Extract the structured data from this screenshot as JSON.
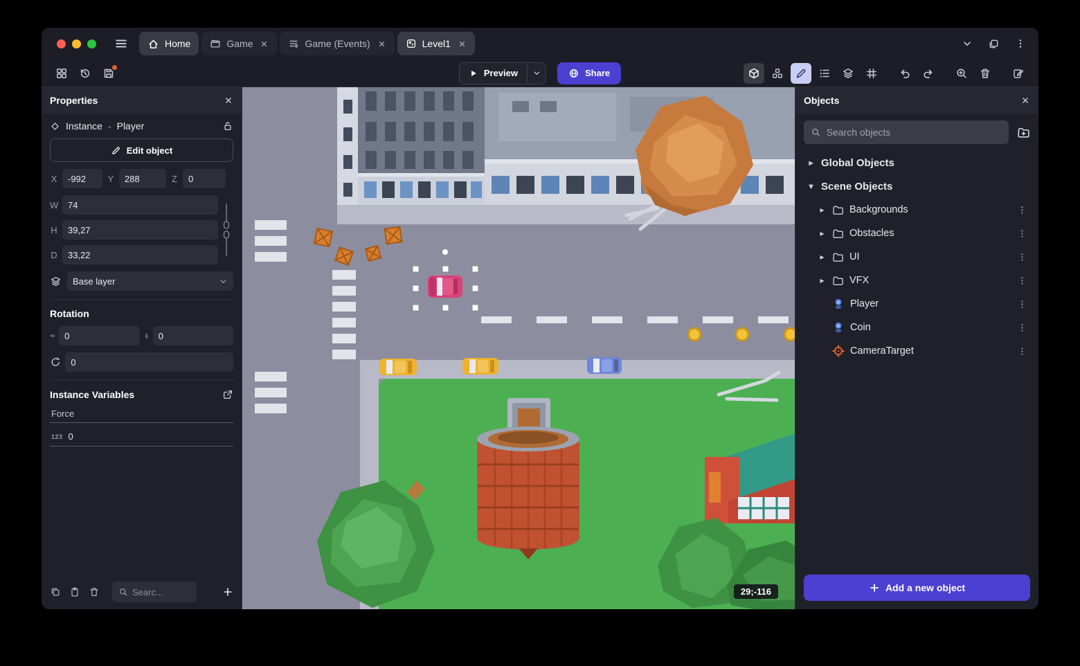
{
  "titlebar": {
    "tabs": [
      {
        "label": "Home"
      },
      {
        "label": "Game"
      },
      {
        "label": "Game (Events)"
      },
      {
        "label": "Level1"
      }
    ]
  },
  "toolbar": {
    "preview_label": "Preview",
    "share_label": "Share"
  },
  "properties_panel": {
    "title": "Properties",
    "instance_label": "Instance",
    "separator": "-",
    "object_name": "Player",
    "edit_object_label": "Edit object",
    "position": {
      "x_label": "X",
      "x": "-992",
      "y_label": "Y",
      "y": "288",
      "z_label": "Z",
      "z": "0"
    },
    "size": {
      "w_label": "W",
      "w": "74",
      "h_label": "H",
      "h": "39,27",
      "d_label": "D",
      "d": "33,22"
    },
    "layer": "Base layer",
    "rotation": {
      "title": "Rotation",
      "x": "0",
      "y": "0",
      "z": "0"
    },
    "instance_variables": {
      "title": "Instance Variables",
      "variables": [
        {
          "name": "Force",
          "type_badge": "123",
          "value": "0"
        }
      ],
      "search_placeholder": "Searc..."
    }
  },
  "objects_panel": {
    "title": "Objects",
    "search_placeholder": "Search objects",
    "global_group_label": "Global Objects",
    "scene_group_label": "Scene Objects",
    "folders": [
      {
        "label": "Backgrounds"
      },
      {
        "label": "Obstacles"
      },
      {
        "label": "UI"
      },
      {
        "label": "VFX"
      }
    ],
    "objects": [
      {
        "label": "Player"
      },
      {
        "label": "Coin"
      },
      {
        "label": "CameraTarget"
      }
    ],
    "add_button_label": "Add a new object"
  },
  "canvas": {
    "coordinates_badge": "29;-116"
  },
  "colors": {
    "accent": "#4c40d2",
    "toolbar_highlight": "#c9cef5",
    "save_badge": "#e2642f",
    "traffic_red": "#ff5f57",
    "traffic_yellow": "#febc2e",
    "traffic_green": "#28c840",
    "player_car": "#d8437a",
    "grass": "#4cb052",
    "road": "#8d8da0"
  }
}
